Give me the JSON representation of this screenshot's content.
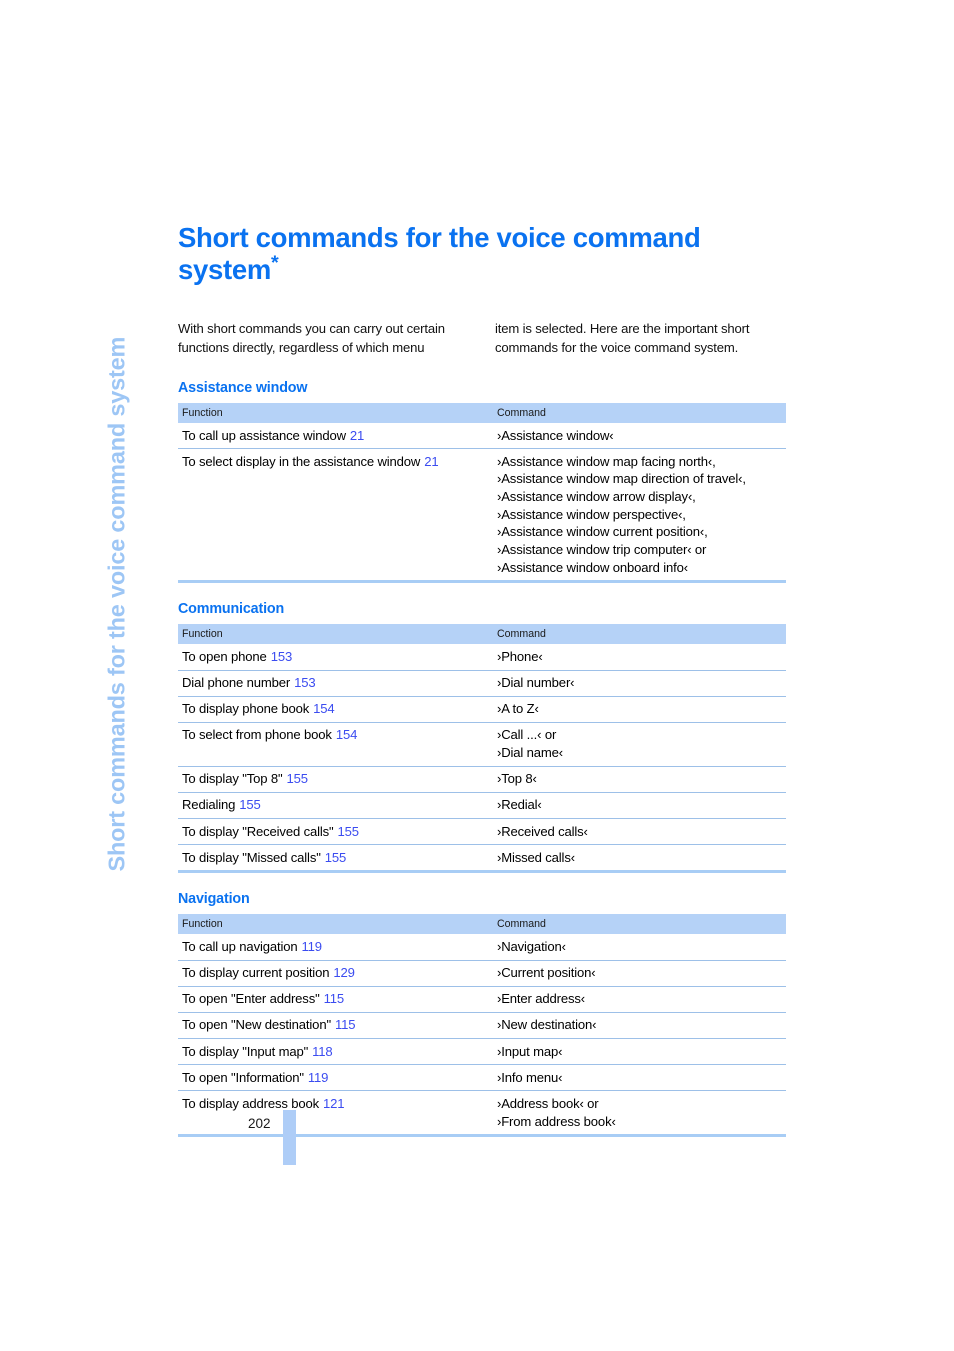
{
  "running_head": "Short commands for the voice command system",
  "title": {
    "text": "Short commands for the voice command system",
    "footnote_mark": "*"
  },
  "intro": {
    "left": "With short commands you can carry out certain functions directly, regardless of which menu",
    "right": "item is selected. Here are the important short commands for the voice command system."
  },
  "table_headers": {
    "function": "Function",
    "command": "Command"
  },
  "sections": [
    {
      "heading": "Assistance window",
      "rows": [
        {
          "function": "To call up assistance window",
          "ref": "21",
          "commands": [
            "›Assistance window‹"
          ]
        },
        {
          "function": "To select display in the assistance window",
          "ref": "21",
          "commands": [
            "›Assistance window map facing north‹,",
            "›Assistance window map direction of travel‹,",
            "›Assistance window arrow display‹,",
            "›Assistance window perspective‹,",
            "›Assistance window current position‹,",
            "›Assistance window trip computer‹ or",
            "›Assistance window onboard info‹"
          ]
        }
      ]
    },
    {
      "heading": "Communication",
      "rows": [
        {
          "function": "To open phone",
          "ref": "153",
          "commands": [
            "›Phone‹"
          ]
        },
        {
          "function": "Dial phone number",
          "ref": "153",
          "commands": [
            "›Dial number‹"
          ]
        },
        {
          "function": "To display phone book",
          "ref": "154",
          "commands": [
            "›A to Z‹"
          ]
        },
        {
          "function": "To select from phone book",
          "ref": "154",
          "commands": [
            "›Call ...‹ or",
            "›Dial name‹"
          ]
        },
        {
          "function": "To display \"Top 8\"",
          "ref": "155",
          "commands": [
            "›Top 8‹"
          ]
        },
        {
          "function": "Redialing",
          "ref": "155",
          "commands": [
            "›Redial‹"
          ]
        },
        {
          "function": "To display \"Received calls\"",
          "ref": "155",
          "commands": [
            "›Received calls‹"
          ]
        },
        {
          "function": "To display \"Missed calls\"",
          "ref": "155",
          "commands": [
            "›Missed calls‹"
          ]
        }
      ]
    },
    {
      "heading": "Navigation",
      "rows": [
        {
          "function": "To call up navigation",
          "ref": "119",
          "commands": [
            "›Navigation‹"
          ]
        },
        {
          "function": "To display current position",
          "ref": "129",
          "commands": [
            "›Current position‹"
          ]
        },
        {
          "function": "To open \"Enter address\"",
          "ref": "115",
          "commands": [
            "›Enter address‹"
          ]
        },
        {
          "function": "To open \"New destination\"",
          "ref": "115",
          "commands": [
            "›New destination‹"
          ]
        },
        {
          "function": "To display \"Input map\"",
          "ref": "118",
          "commands": [
            "›Input map‹"
          ]
        },
        {
          "function": "To open \"Information\"",
          "ref": "119",
          "commands": [
            "›Info menu‹"
          ]
        },
        {
          "function": "To display address book",
          "ref": "121",
          "commands": [
            "›Address book‹ or",
            "›From address book‹"
          ]
        }
      ]
    }
  ],
  "folio": {
    "page_number": "202"
  },
  "colors": {
    "accent_blue": "#0a72f0",
    "header_fill": "#b5d2f7",
    "running_head": "#9dc6f5",
    "reference_blue": "#3b4cf0",
    "rule": "#9dc0e8"
  }
}
